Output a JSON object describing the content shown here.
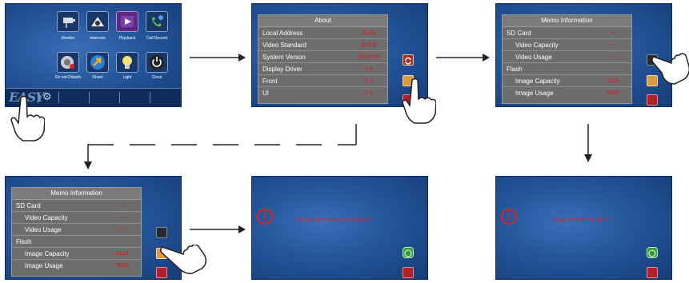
{
  "main_menu": {
    "brand": "EASY",
    "items": [
      {
        "label": "Monitor",
        "icon": "camera-icon"
      },
      {
        "label": "Intercom",
        "icon": "intercom-icon"
      },
      {
        "label": "Playback",
        "icon": "playback-icon"
      },
      {
        "label": "Call Record",
        "icon": "call-record-icon"
      },
      {
        "label": "Do not Disturb",
        "icon": "do-not-disturb-icon"
      },
      {
        "label": "Divert",
        "icon": "divert-icon"
      },
      {
        "label": "Light",
        "icon": "light-bulb-icon"
      },
      {
        "label": "Close",
        "icon": "power-icon"
      }
    ]
  },
  "about": {
    "title": "About",
    "rows": [
      {
        "key": "Local Address",
        "value": "00.00"
      },
      {
        "key": "Video Standard",
        "value": "AUTO"
      },
      {
        "key": "System Verson",
        "value": "00.01.00"
      },
      {
        "key": "Display Driver",
        "value": "1.0"
      },
      {
        "key": "Front",
        "value": "1.0"
      },
      {
        "key": "UI",
        "value": "1.0"
      }
    ]
  },
  "memo": {
    "title": "Memo Information",
    "rows": [
      {
        "key": "SD Card",
        "value": "--",
        "indent": false
      },
      {
        "key": "Video Capacity",
        "value": "----",
        "indent": true
      },
      {
        "key": "Video Usage",
        "value": "-----",
        "indent": true
      },
      {
        "key": "Flash",
        "value": "",
        "indent": false
      },
      {
        "key": "Image Capacity",
        "value": "0118",
        "indent": true
      },
      {
        "key": "Image Usage",
        "value": "0000",
        "indent": true
      }
    ]
  },
  "format_dialog": {
    "message": "Format SD Card And Restart ?",
    "ok": "OK"
  },
  "copy_dialog": {
    "message": "Copy Pictures To SD ?",
    "ok": "OK"
  },
  "colors": {
    "value_red": "#e01010",
    "panel_gray": "#6d6d6d",
    "screen_blue": "#24559b"
  }
}
